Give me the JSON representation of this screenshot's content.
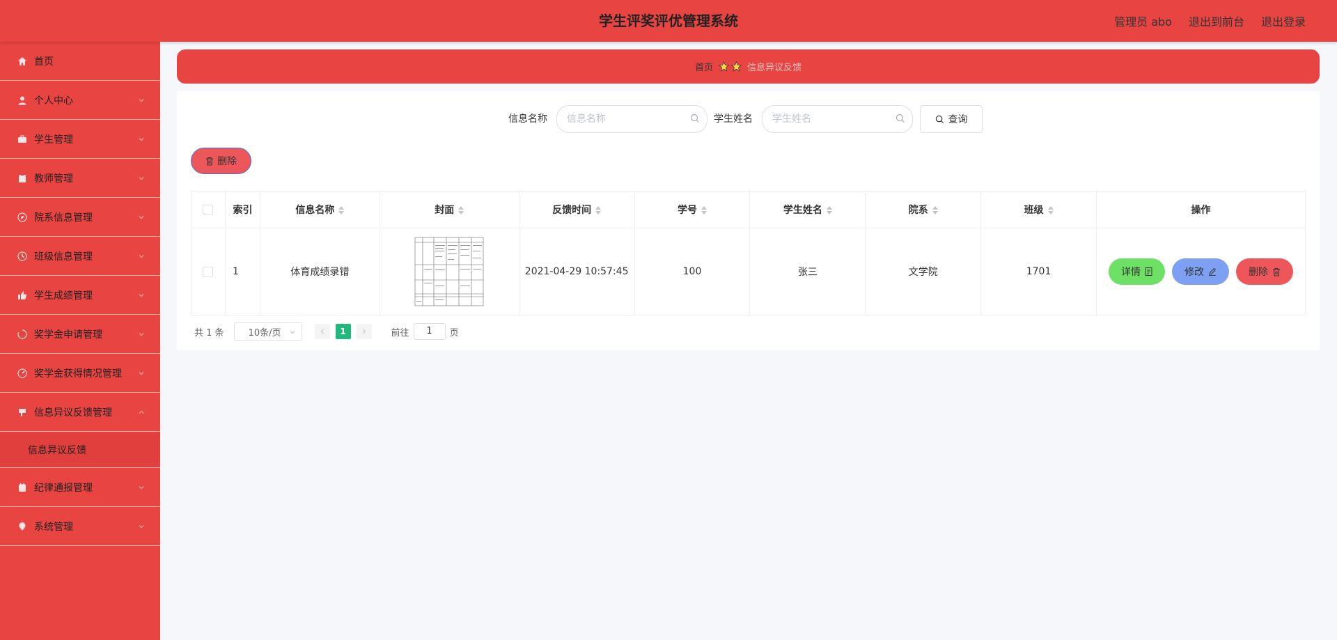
{
  "header": {
    "title": "学生评奖评优管理系统",
    "admin": "管理员 abo",
    "to_front": "退出到前台",
    "logout": "退出登录"
  },
  "sidebar": {
    "items": [
      {
        "label": "首页",
        "icon": "home-icon"
      },
      {
        "label": "个人中心",
        "icon": "user-icon"
      },
      {
        "label": "学生管理",
        "icon": "briefcase-icon"
      },
      {
        "label": "教师管理",
        "icon": "clipboard-icon"
      },
      {
        "label": "院系信息管理",
        "icon": "compass-icon"
      },
      {
        "label": "班级信息管理",
        "icon": "clock-icon"
      },
      {
        "label": "学生成绩管理",
        "icon": "thumb-icon"
      },
      {
        "label": "奖学金申请管理",
        "icon": "loading-icon"
      },
      {
        "label": "奖学金获得情况管理",
        "icon": "gauge-icon"
      },
      {
        "label": "信息异议反馈管理",
        "icon": "flag-icon"
      },
      {
        "label": "纪律通报管理",
        "icon": "calendar-icon"
      },
      {
        "label": "系统管理",
        "icon": "location-icon"
      }
    ],
    "submenu": {
      "label": "信息异议反馈"
    }
  },
  "breadcrumb": {
    "home": "首页",
    "current": "信息异议反馈"
  },
  "search": {
    "label1": "信息名称",
    "placeholder1": "信息名称",
    "value1": "",
    "label2": "学生姓名",
    "placeholder2": "学生姓名",
    "value2": "",
    "query": "查询"
  },
  "toolbar": {
    "delete": "删除"
  },
  "table": {
    "headers": [
      "索引",
      "信息名称",
      "封面",
      "反馈时间",
      "学号",
      "学生姓名",
      "院系",
      "班级",
      "操作"
    ],
    "rows": [
      {
        "index": "1",
        "name": "体育成绩录错",
        "time": "2021-04-29 10:57:45",
        "student_id": "100",
        "student_name": "张三",
        "department": "文学院",
        "class": "1701"
      }
    ],
    "actions": {
      "detail": "详情",
      "edit": "修改",
      "remove": "删除"
    }
  },
  "pagination": {
    "total": "共 1 条",
    "page_size": "10条/页",
    "current": "1",
    "goto": "前往",
    "page_value": "1",
    "page_unit": "页"
  },
  "colors": {
    "primary": "#e84442",
    "detail": "#6ee066",
    "edit": "#7ea0f2",
    "remove": "#ee575a",
    "page_active": "#21b87c"
  }
}
